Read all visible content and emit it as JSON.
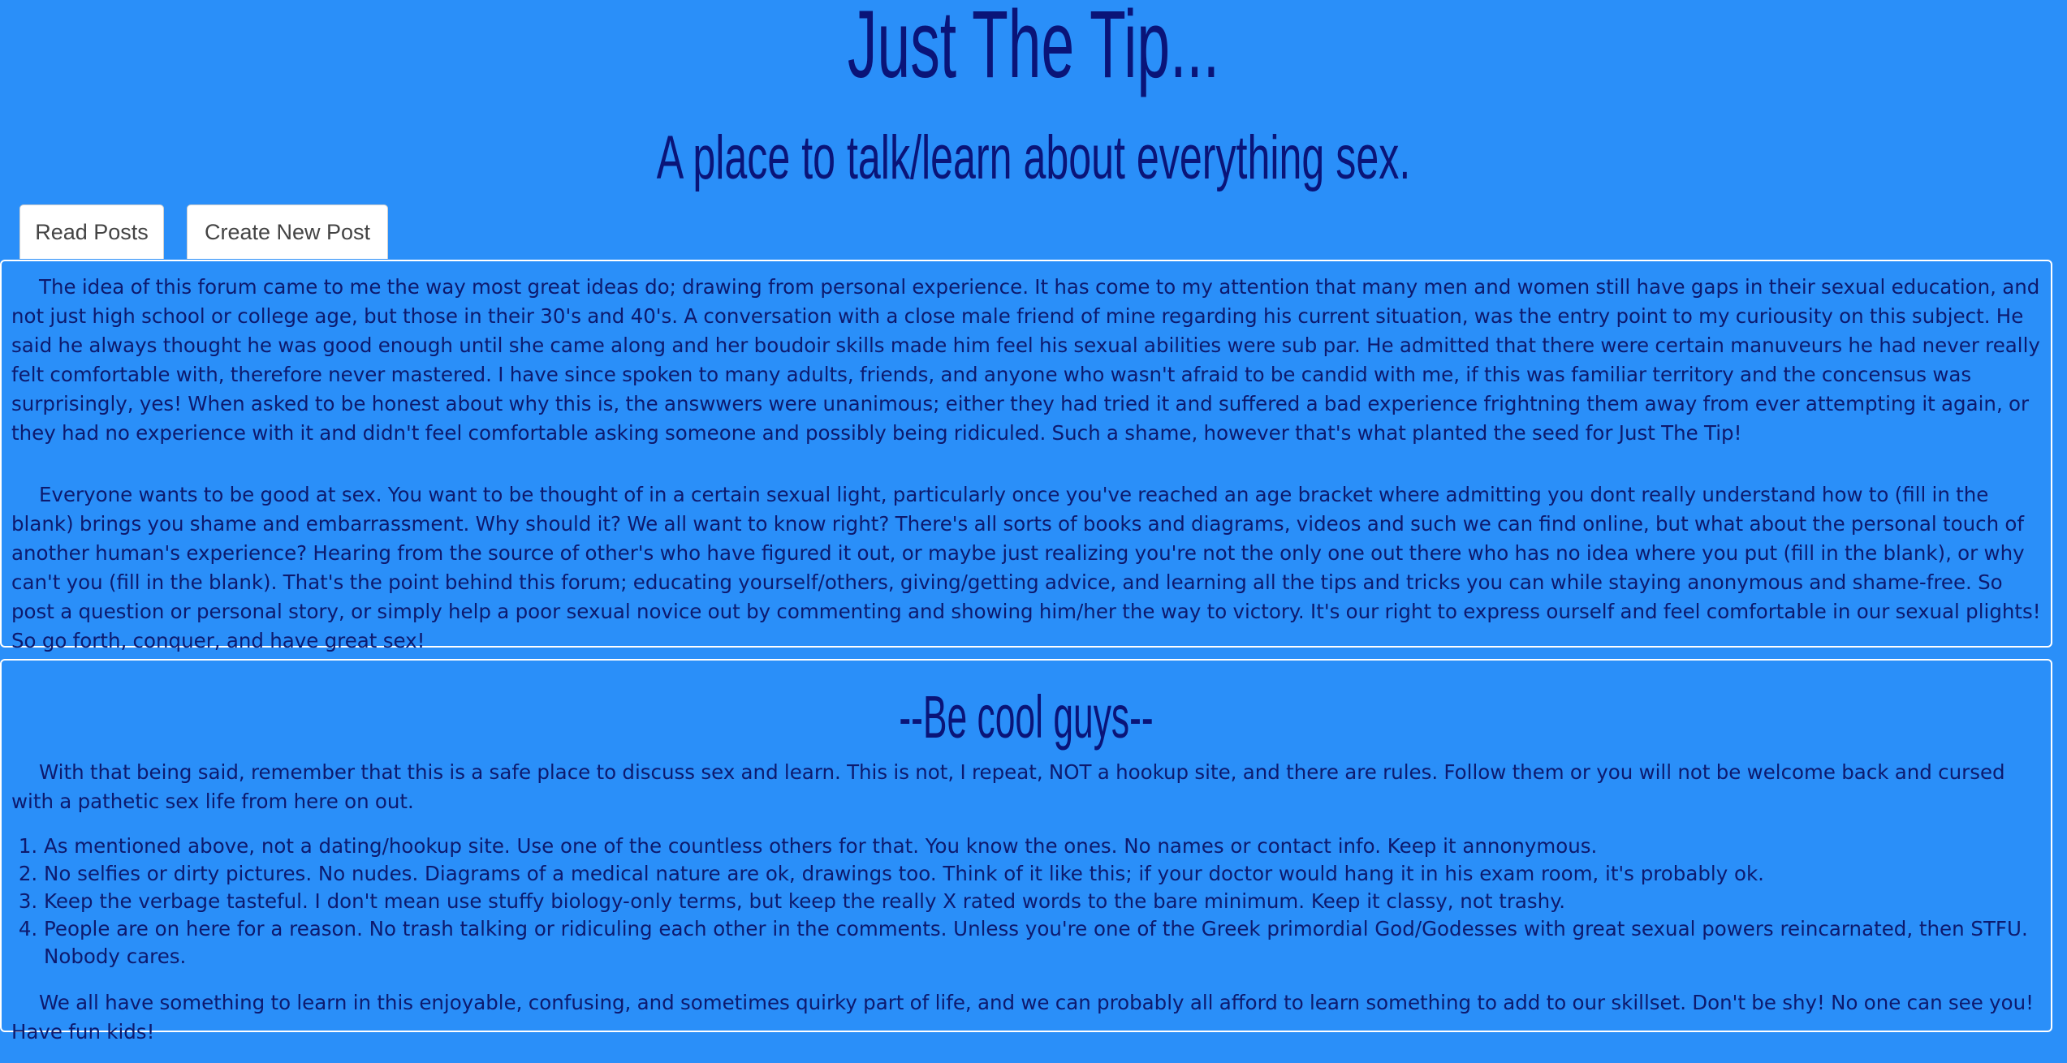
{
  "header": {
    "title": "Just The Tip...",
    "subtitle": "A place to talk/learn about everything sex."
  },
  "tabs": [
    {
      "label": "Read Posts"
    },
    {
      "label": "Create New Post"
    }
  ],
  "intro": {
    "paragraphs": [
      "The idea of this forum came to me the way most great ideas do; drawing from personal experience. It has come to my attention that many men and women still have gaps in their sexual education, and not just high school or college age, but those in their 30's and 40's. A conversation with a close male friend of mine regarding his current situation, was the entry point to my curiousity on this subject. He said he always thought he was good enough until she came along and her boudoir skills made him feel his sexual abilities were sub par. He admitted that there were certain manuveurs he had never really felt comfortable with, therefore never mastered. I have since spoken to many adults, friends, and anyone who wasn't afraid to be candid with me, if this was familiar territory and the concensus was surprisingly, yes! When asked to be honest about why this is, the answwers were unanimous; either they had tried it and suffered a bad experience frightning them away from ever attempting it again, or they had no experience with it and didn't feel comfortable asking someone and possibly being ridiculed. Such a shame, however that's what planted the seed for Just The Tip!",
      "Everyone wants to be good at sex. You want to be thought of in a certain sexual light, particularly once you've reached an age bracket where admitting you dont really understand how to (fill in the blank) brings you shame and embarrassment. Why should it? We all want to know right? There's all sorts of books and diagrams, videos and such we can find online, but what about the personal touch of another human's experience? Hearing from the source of other's who have figured it out, or maybe just realizing you're not the only one out there who has no idea where you put (fill in the blank), or why can't you (fill in the blank). That's the point behind this forum; educating yourself/others, giving/getting advice, and learning all the tips and tricks you can while staying anonymous and shame-free. So post a question or personal story, or simply help a poor sexual novice out by commenting and showing him/her the way to victory. It's our right to express ourself and feel comfortable in our sexual plights! So go forth, conquer, and have great sex!"
    ]
  },
  "rules": {
    "heading": "--Be cool guys--",
    "intro": "With that being said, remember that this is a safe place to discuss sex and learn. This is not, I repeat, NOT a hookup site, and there are rules. Follow them or you will not be welcome back and cursed with a pathetic sex life from here on out.",
    "items": [
      "As mentioned above, not a dating/hookup site. Use one of the countless others for that. You know the ones. No names or contact info. Keep it annonymous.",
      "No selfies or dirty pictures. No nudes. Diagrams of a medical nature are ok, drawings too. Think of it like this; if your doctor would hang it in his exam room, it's probably ok.",
      "Keep the verbage tasteful. I don't mean use stuffy biology-only terms, but keep the really X rated words to the bare minimum. Keep it classy, not trashy.",
      "People are on here for a reason. No trash talking or ridiculing each other in the comments. Unless you're one of the Greek primordial God/Godesses with great sexual powers reincarnated, then STFU. Nobody cares."
    ],
    "outro": "We all have something to learn in this enjoyable, confusing, and sometimes quirky part of life, and we can probably all afford to learn something to add to our skillset. Don't be shy! No one can see you! Have fun kids!"
  },
  "colors": {
    "background": "#2a8ff9",
    "text": "#0d1a6e",
    "heading": "#0a1478",
    "panel_border": "#ffffff",
    "tab_background": "#ffffff"
  }
}
